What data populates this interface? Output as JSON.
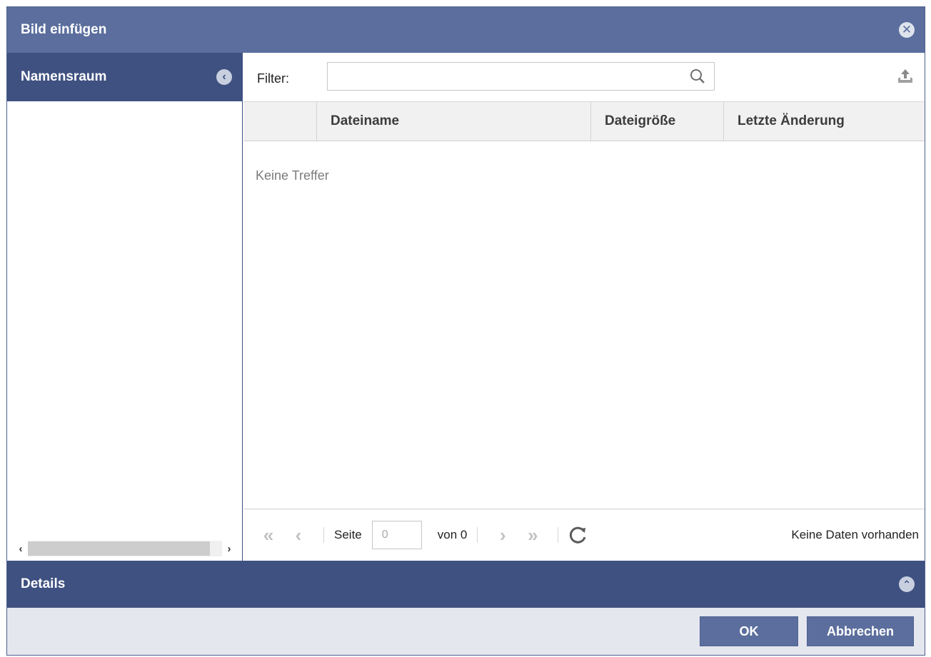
{
  "dialog": {
    "title": "Bild einfügen",
    "close_icon": "close-circle-icon"
  },
  "namespace": {
    "header": "Namensraum",
    "collapse_icon": "chevron-left-circle-icon",
    "scroll_left": "‹",
    "scroll_right": "›"
  },
  "filter": {
    "label": "Filter:",
    "value": "",
    "placeholder": "",
    "search_icon": "search-icon",
    "upload_icon": "upload-icon"
  },
  "grid": {
    "columns": [
      "",
      "Dateiname",
      "Dateigröße",
      "Letzte Änderung"
    ],
    "rows": [],
    "empty_text": "Keine Treffer"
  },
  "pager": {
    "page_label": "Seite",
    "page_value": "0",
    "of_label": "von 0",
    "status": "Keine Daten vorhanden",
    "first_icon": "double-chevron-left-icon",
    "prev_icon": "chevron-left-icon",
    "next_icon": "chevron-right-icon",
    "last_icon": "double-chevron-right-icon",
    "refresh_icon": "refresh-icon"
  },
  "details": {
    "header": "Details",
    "toggle_icon": "chevron-up-circle-icon"
  },
  "footer": {
    "ok_label": "OK",
    "cancel_label": "Abbrechen"
  },
  "colors": {
    "titlebar": "#5b6e9d",
    "panel_header": "#3f5181",
    "footer_bg": "#e5e7ee"
  }
}
